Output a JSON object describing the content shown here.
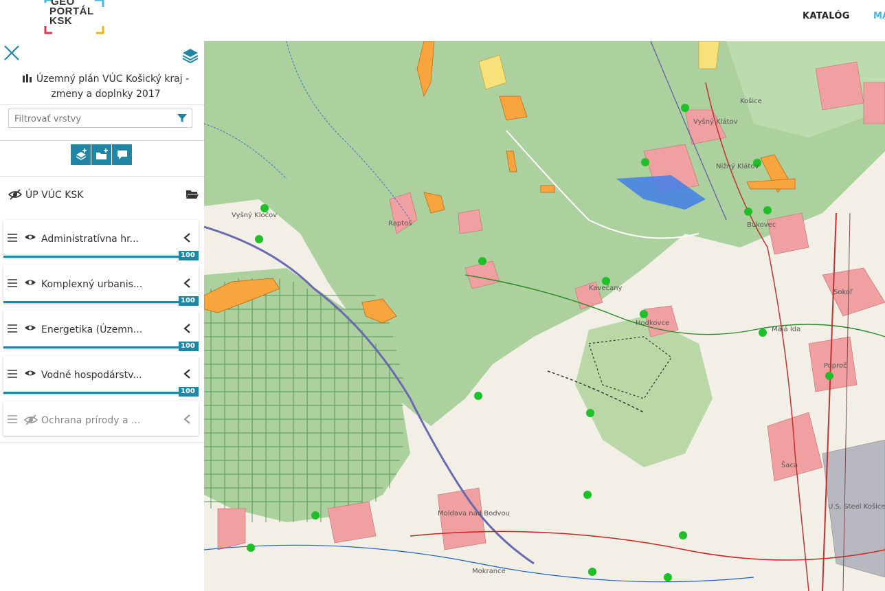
{
  "header": {
    "logo_line1": "GEO",
    "logo_line2": "PORTÁL",
    "logo_line3": "KSK",
    "nav_catalog": "KATALÓG",
    "nav_map": "MA"
  },
  "sidebar": {
    "plan_title_line1": "Územný plán VÚC Košický kraj -",
    "plan_title_line2": "zmeny a doplnky 2017",
    "filter_placeholder": "Filtrovať vrstvy",
    "group_label": "ÚP VÚC KSK",
    "layers": [
      {
        "name": "Administratívna hr...",
        "opacity": "100 %",
        "visible": true
      },
      {
        "name": "Komplexný urbanis...",
        "opacity": "100 %",
        "visible": true
      },
      {
        "name": "Energetika (Územn...",
        "opacity": "100 %",
        "visible": true
      },
      {
        "name": "Vodné hospodárstv...",
        "opacity": "100 %",
        "visible": true
      },
      {
        "name": "Ochrana prírody a ...",
        "opacity": "",
        "visible": false
      }
    ]
  },
  "map": {
    "labels": [
      "Vyšný Klátov",
      "Kavečany",
      "Nižný Klátov",
      "Vyšný Kločov",
      "Raptoš",
      "Bukovec",
      "Hodkovce",
      "Malá Ida",
      "Sokoľ",
      "Poproč",
      "Moldava nad Bodvou",
      "Mokrance",
      "U.S. Steel Košice",
      "Šaca",
      "Košice"
    ]
  },
  "colors": {
    "accent": "#1f86a6",
    "forest": "#a8d08d",
    "settlement": "#f0a0a0",
    "development": "#f7a53c"
  }
}
